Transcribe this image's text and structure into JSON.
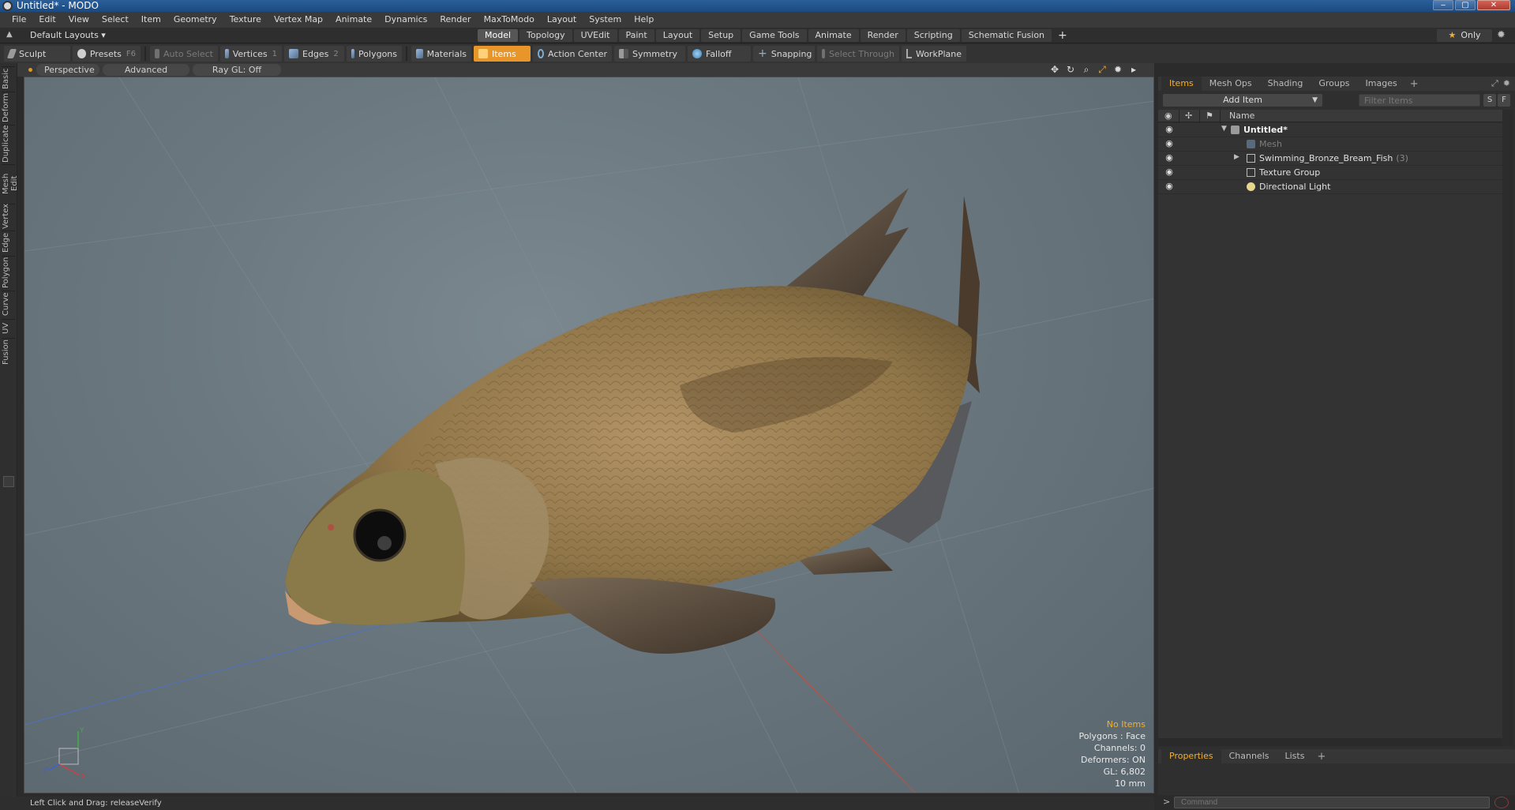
{
  "window": {
    "title": "Untitled* - MODO",
    "min": "‒",
    "max": "▢",
    "close": "✕"
  },
  "menu": [
    "File",
    "Edit",
    "View",
    "Select",
    "Item",
    "Geometry",
    "Texture",
    "Vertex Map",
    "Animate",
    "Dynamics",
    "Render",
    "MaxToModo",
    "Layout",
    "System",
    "Help"
  ],
  "layouts": {
    "dropdown": "Default Layouts ▾",
    "tabs": [
      "Model",
      "Topology",
      "UVEdit",
      "Paint",
      "Layout",
      "Setup",
      "Game Tools",
      "Animate",
      "Render",
      "Scripting",
      "Schematic Fusion"
    ],
    "active_tab": "Model",
    "add": "+",
    "only": "Only"
  },
  "toolbar": {
    "sculpt": "Sculpt",
    "presets": "Presets",
    "presets_key": "F6",
    "auto_select": "Auto Select",
    "vertices": "Vertices",
    "vertices_key": "1",
    "edges": "Edges",
    "edges_key": "2",
    "polygons": "Polygons",
    "materials": "Materials",
    "items": "Items",
    "action_center": "Action Center",
    "symmetry": "Symmetry",
    "falloff": "Falloff",
    "snapping": "Snapping",
    "select_through": "Select Through",
    "workplane": "WorkPlane"
  },
  "left_tabs": [
    "Basic",
    "Deform",
    "Duplicate",
    "Mesh Edit",
    "Vertex",
    "Edge",
    "Polygon",
    "Curve",
    "UV",
    "Fusion"
  ],
  "viewport": {
    "perspective": "Perspective",
    "advanced": "Advanced",
    "raygl": "Ray GL: Off",
    "info": {
      "no_items": "No Items",
      "polygons": "Polygons : Face",
      "channels": "Channels: 0",
      "deformers": "Deformers: ON",
      "gl": "GL: 6,802",
      "scale": "10 mm"
    }
  },
  "status": {
    "text": "Left Click and Drag:   releaseVerify"
  },
  "items_panel": {
    "tabs": [
      "Items",
      "Mesh Ops",
      "Shading",
      "Groups",
      "Images"
    ],
    "active_tab": "Items",
    "add": "+",
    "add_item": "Add Item",
    "filter_placeholder": "Filter Items",
    "s_btn": "S",
    "f_btn": "F",
    "col_name": "Name",
    "rows": [
      {
        "label": "Untitled*",
        "count": ""
      },
      {
        "label": "Mesh",
        "count": ""
      },
      {
        "label": "Swimming_Bronze_Bream_Fish",
        "count": "(3)"
      },
      {
        "label": "Texture Group",
        "count": ""
      },
      {
        "label": "Directional Light",
        "count": ""
      }
    ]
  },
  "properties_panel": {
    "tabs": [
      "Properties",
      "Channels",
      "Lists"
    ],
    "active_tab": "Properties",
    "add": "+"
  },
  "command": {
    "prompt": ">",
    "placeholder": "Command"
  },
  "colors": {
    "accent": "#e8952a",
    "active_text": "#f2b030",
    "viewport_bg": "#6b7880"
  }
}
